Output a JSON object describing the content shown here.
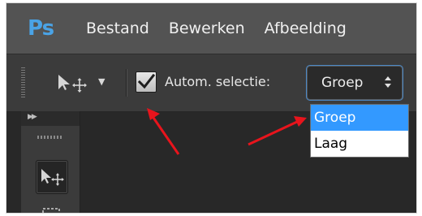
{
  "app": {
    "logo": "Ps"
  },
  "menu": [
    "Bestand",
    "Bewerken",
    "Afbeelding"
  ],
  "options_bar": {
    "tool_icon": "move-tool-icon",
    "auto_select": {
      "label": "Autom. selectie:",
      "checked": true
    },
    "select": {
      "value": "Groep"
    }
  },
  "dropdown": {
    "options": [
      "Groep",
      "Laag"
    ],
    "selected": "Groep"
  },
  "colors": {
    "menubar": "#535353",
    "optbar": "#3b3b3b",
    "highlight": "#3399ff",
    "logo": "#4aa3e6",
    "arrow": "#e8141c"
  }
}
